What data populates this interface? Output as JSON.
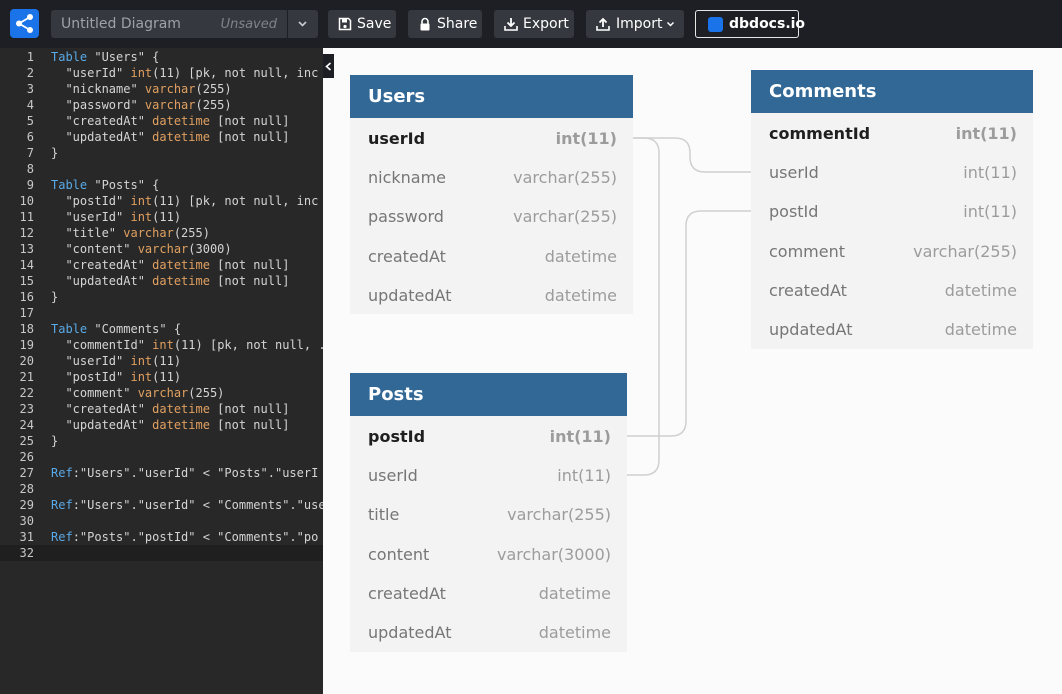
{
  "toolbar": {
    "diagram_name": "Untitled Diagram",
    "save_status": "Unsaved",
    "save_label": "Save",
    "share_label": "Share",
    "export_label": "Export",
    "import_label": "Import",
    "dbdocs_label": "dbdocs.io"
  },
  "editor": {
    "lines": [
      {
        "num": "1",
        "segs": [
          {
            "k": "kw",
            "t": "Table"
          },
          {
            "k": "",
            "t": " \"Users\" {"
          }
        ]
      },
      {
        "num": "2",
        "segs": [
          {
            "k": "",
            "t": "  \"userId\" "
          },
          {
            "k": "ty",
            "t": "int"
          },
          {
            "k": "",
            "t": "(11) [pk, not null, inc"
          }
        ]
      },
      {
        "num": "3",
        "segs": [
          {
            "k": "",
            "t": "  \"nickname\" "
          },
          {
            "k": "ty",
            "t": "varchar"
          },
          {
            "k": "",
            "t": "(255)"
          }
        ]
      },
      {
        "num": "4",
        "segs": [
          {
            "k": "",
            "t": "  \"password\" "
          },
          {
            "k": "ty",
            "t": "varchar"
          },
          {
            "k": "",
            "t": "(255)"
          }
        ]
      },
      {
        "num": "5",
        "segs": [
          {
            "k": "",
            "t": "  \"createdAt\" "
          },
          {
            "k": "ty",
            "t": "datetime"
          },
          {
            "k": "",
            "t": " [not null]"
          }
        ]
      },
      {
        "num": "6",
        "segs": [
          {
            "k": "",
            "t": "  \"updatedAt\" "
          },
          {
            "k": "ty",
            "t": "datetime"
          },
          {
            "k": "",
            "t": " [not null]"
          }
        ]
      },
      {
        "num": "7",
        "segs": [
          {
            "k": "",
            "t": "}"
          }
        ]
      },
      {
        "num": "8",
        "segs": []
      },
      {
        "num": "9",
        "segs": [
          {
            "k": "kw",
            "t": "Table"
          },
          {
            "k": "",
            "t": " \"Posts\" {"
          }
        ]
      },
      {
        "num": "10",
        "segs": [
          {
            "k": "",
            "t": "  \"postId\" "
          },
          {
            "k": "ty",
            "t": "int"
          },
          {
            "k": "",
            "t": "(11) [pk, not null, inc"
          }
        ]
      },
      {
        "num": "11",
        "segs": [
          {
            "k": "",
            "t": "  \"userId\" "
          },
          {
            "k": "ty",
            "t": "int"
          },
          {
            "k": "",
            "t": "(11)"
          }
        ]
      },
      {
        "num": "12",
        "segs": [
          {
            "k": "",
            "t": "  \"title\" "
          },
          {
            "k": "ty",
            "t": "varchar"
          },
          {
            "k": "",
            "t": "(255)"
          }
        ]
      },
      {
        "num": "13",
        "segs": [
          {
            "k": "",
            "t": "  \"content\" "
          },
          {
            "k": "ty",
            "t": "varchar"
          },
          {
            "k": "",
            "t": "(3000)"
          }
        ]
      },
      {
        "num": "14",
        "segs": [
          {
            "k": "",
            "t": "  \"createdAt\" "
          },
          {
            "k": "ty",
            "t": "datetime"
          },
          {
            "k": "",
            "t": " [not null]"
          }
        ]
      },
      {
        "num": "15",
        "segs": [
          {
            "k": "",
            "t": "  \"updatedAt\" "
          },
          {
            "k": "ty",
            "t": "datetime"
          },
          {
            "k": "",
            "t": " [not null]"
          }
        ]
      },
      {
        "num": "16",
        "segs": [
          {
            "k": "",
            "t": "}"
          }
        ]
      },
      {
        "num": "17",
        "segs": []
      },
      {
        "num": "18",
        "segs": [
          {
            "k": "kw",
            "t": "Table"
          },
          {
            "k": "",
            "t": " \"Comments\" {"
          }
        ]
      },
      {
        "num": "19",
        "segs": [
          {
            "k": "",
            "t": "  \"commentId\" "
          },
          {
            "k": "ty",
            "t": "int"
          },
          {
            "k": "",
            "t": "(11) [pk, not null, ."
          }
        ]
      },
      {
        "num": "20",
        "segs": [
          {
            "k": "",
            "t": "  \"userId\" "
          },
          {
            "k": "ty",
            "t": "int"
          },
          {
            "k": "",
            "t": "(11)"
          }
        ]
      },
      {
        "num": "21",
        "segs": [
          {
            "k": "",
            "t": "  \"postId\" "
          },
          {
            "k": "ty",
            "t": "int"
          },
          {
            "k": "",
            "t": "(11)"
          }
        ]
      },
      {
        "num": "22",
        "segs": [
          {
            "k": "",
            "t": "  \"comment\" "
          },
          {
            "k": "ty",
            "t": "varchar"
          },
          {
            "k": "",
            "t": "(255)"
          }
        ]
      },
      {
        "num": "23",
        "segs": [
          {
            "k": "",
            "t": "  \"createdAt\" "
          },
          {
            "k": "ty",
            "t": "datetime"
          },
          {
            "k": "",
            "t": " [not null]"
          }
        ]
      },
      {
        "num": "24",
        "segs": [
          {
            "k": "",
            "t": "  \"updatedAt\" "
          },
          {
            "k": "ty",
            "t": "datetime"
          },
          {
            "k": "",
            "t": " [not null]"
          }
        ]
      },
      {
        "num": "25",
        "segs": [
          {
            "k": "",
            "t": "}"
          }
        ]
      },
      {
        "num": "26",
        "segs": []
      },
      {
        "num": "27",
        "segs": [
          {
            "k": "kw",
            "t": "Ref"
          },
          {
            "k": "",
            "t": ":\"Users\".\"userId\" < \"Posts\".\"userI"
          }
        ]
      },
      {
        "num": "28",
        "segs": []
      },
      {
        "num": "29",
        "segs": [
          {
            "k": "kw",
            "t": "Ref"
          },
          {
            "k": "",
            "t": ":\"Users\".\"userId\" < \"Comments\".\"use"
          }
        ]
      },
      {
        "num": "30",
        "segs": []
      },
      {
        "num": "31",
        "segs": [
          {
            "k": "kw",
            "t": "Ref"
          },
          {
            "k": "",
            "t": ":\"Posts\".\"postId\" < \"Comments\".\"po"
          }
        ]
      },
      {
        "num": "32",
        "segs": [],
        "active": true
      }
    ]
  },
  "diagram": {
    "tables": {
      "users": {
        "name": "Users",
        "fields": [
          {
            "name": "userId",
            "type": "int(11)",
            "pk": true
          },
          {
            "name": "nickname",
            "type": "varchar(255)"
          },
          {
            "name": "password",
            "type": "varchar(255)"
          },
          {
            "name": "createdAt",
            "type": "datetime"
          },
          {
            "name": "updatedAt",
            "type": "datetime"
          }
        ]
      },
      "posts": {
        "name": "Posts",
        "fields": [
          {
            "name": "postId",
            "type": "int(11)",
            "pk": true
          },
          {
            "name": "userId",
            "type": "int(11)"
          },
          {
            "name": "title",
            "type": "varchar(255)"
          },
          {
            "name": "content",
            "type": "varchar(3000)"
          },
          {
            "name": "createdAt",
            "type": "datetime"
          },
          {
            "name": "updatedAt",
            "type": "datetime"
          }
        ]
      },
      "comments": {
        "name": "Comments",
        "fields": [
          {
            "name": "commentId",
            "type": "int(11)",
            "pk": true
          },
          {
            "name": "userId",
            "type": "int(11)"
          },
          {
            "name": "postId",
            "type": "int(11)"
          },
          {
            "name": "comment",
            "type": "varchar(255)"
          },
          {
            "name": "createdAt",
            "type": "datetime"
          },
          {
            "name": "updatedAt",
            "type": "datetime"
          }
        ]
      }
    },
    "colors": {
      "header": "#316896",
      "connector": "#d0d0d0",
      "keyword": "#5aa9e6",
      "type": "#e0a060"
    }
  }
}
